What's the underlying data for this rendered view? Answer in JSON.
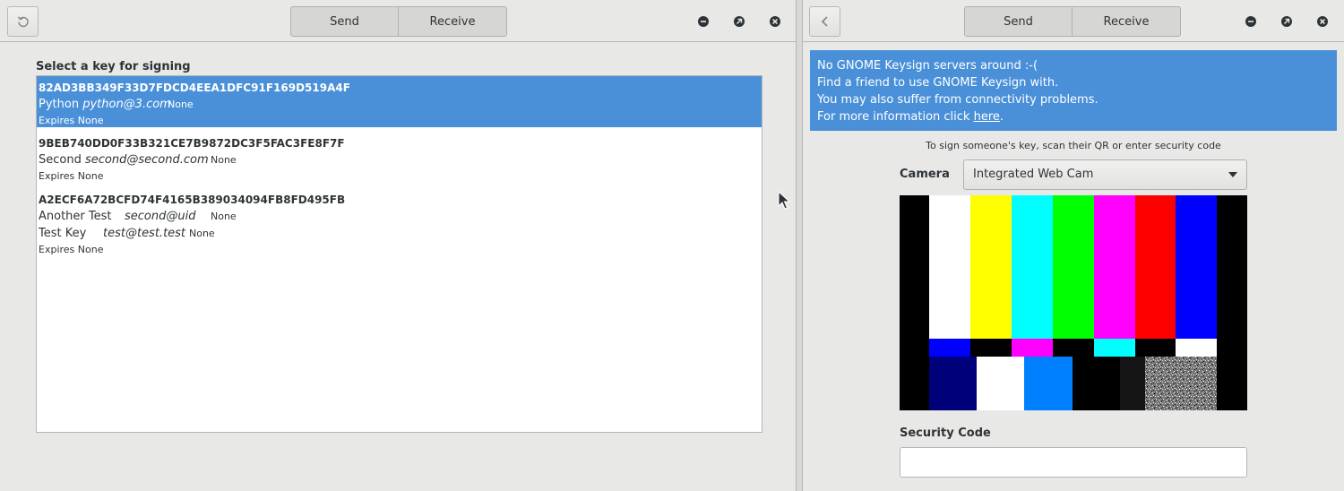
{
  "left": {
    "header": {
      "send_label": "Send",
      "receive_label": "Receive"
    },
    "heading": "Select a key for signing",
    "keys": [
      {
        "fingerprint": "82AD3BB349F33D7FDCD4EEA1DFC91F169D519A4F",
        "uids": [
          {
            "name": "Python",
            "email": "python@3.com",
            "comment": "None"
          }
        ],
        "expires": "Expires None",
        "selected": true
      },
      {
        "fingerprint": "9BEB740DD0F33B321CE7B9872DC3F5FAC3FE8F7F",
        "uids": [
          {
            "name": "Second",
            "email": "second@second.com",
            "comment": "None"
          }
        ],
        "expires": "Expires None"
      },
      {
        "fingerprint": "A2ECF6A72BCFD74F4165B389034094FB8FD495FB",
        "uids": [
          {
            "name": "Another Test",
            "email": "second@uid",
            "comment": "None"
          },
          {
            "name": "Test Key",
            "email": "test@test.test",
            "comment": "None"
          }
        ],
        "expires": "Expires None"
      }
    ]
  },
  "right": {
    "header": {
      "send_label": "Send",
      "receive_label": "Receive"
    },
    "banner": {
      "line1": "No GNOME Keysign servers around :-(",
      "line2": "Find a friend to use GNOME Keysign with.",
      "line3": "You may also suffer from connectivity problems.",
      "line4_prefix": "For more information click ",
      "line4_link": "here",
      "line4_suffix": "."
    },
    "instruction": "To sign someone's key, scan their QR or enter security code",
    "camera_label": "Camera",
    "camera_value": "Integrated Web Cam",
    "security_code_label": "Security Code",
    "security_code_value": ""
  },
  "colors": {
    "accent": "#4a90d9",
    "window_bg": "#e8e8e7"
  },
  "icons": [
    "refresh-icon",
    "back-icon",
    "minimize-icon",
    "maximize-icon",
    "close-icon",
    "dropdown-arrow-icon",
    "mouse-cursor-icon"
  ]
}
